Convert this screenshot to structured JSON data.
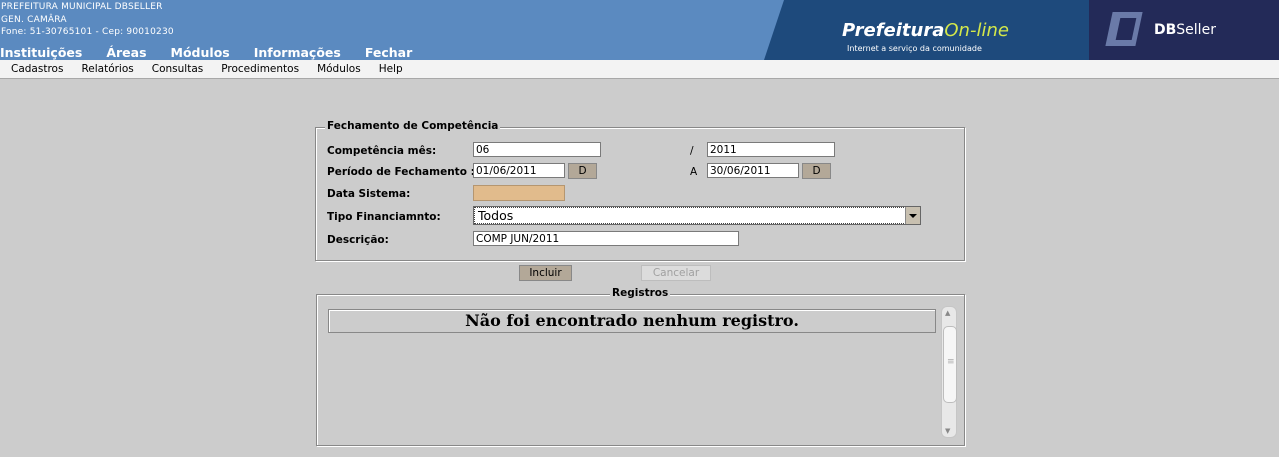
{
  "header": {
    "org_line1": "PREFEITURA MUNICIPAL DBSELLER",
    "org_line2": "GEN. CAMÂRA",
    "org_line3": "Fone: 51-30765101  -  Cep: 90010230",
    "nav": [
      "Instituições",
      "Áreas",
      "Módulos",
      "Informações",
      "Fechar"
    ],
    "brand_title": "Prefeitura",
    "brand_title_accent": "On-line",
    "brand_tagline": "Internet a serviço da comunidade",
    "vendor_prefix": "DB",
    "vendor_suffix": "Seller"
  },
  "menubar": [
    "Cadastros",
    "Relatórios",
    "Consultas",
    "Procedimentos",
    "Módulos",
    "Help"
  ],
  "form": {
    "legend": "Fechamento de Competência",
    "competencia_label": "Competência mês:",
    "competencia_mes": "06",
    "competencia_sep": "/",
    "competencia_ano": "2011",
    "periodo_label": "Período de Fechamento :",
    "periodo_inicio": "01/06/2011",
    "periodo_sep": "A",
    "periodo_fim": "30/06/2011",
    "date_button": "D",
    "data_sistema_label": "Data Sistema:",
    "data_sistema_value": "",
    "tipo_label": "Tipo Financiamnto:",
    "tipo_value": "Todos",
    "descricao_label": "Descrição:",
    "descricao_value": "COMP JUN/2011"
  },
  "actions": {
    "incluir": "Incluir",
    "cancelar": "Cancelar"
  },
  "registros": {
    "legend": "Registros",
    "empty_message": "Não foi encontrado nenhum registro."
  },
  "colors": {
    "header_bg": "#5b8ac0",
    "brand_bg": "#1e4a7c",
    "vendor_bg": "#232a58",
    "data_sistema_bg": "#e1bb8c",
    "page_bg": "#cccccc"
  }
}
